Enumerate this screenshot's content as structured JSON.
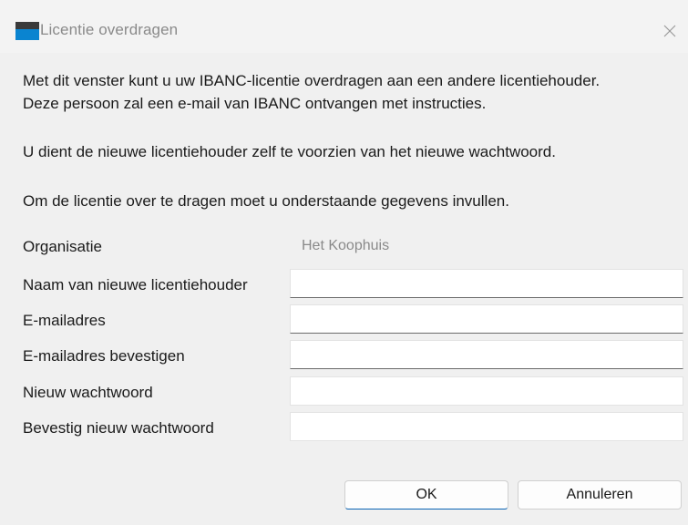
{
  "window": {
    "title": "Licentie overdragen",
    "close_label": "×"
  },
  "intro": {
    "line1": "Met dit venster kunt u uw IBANC-licentie overdragen aan een andere licentiehouder.",
    "line2": "Deze persoon zal een e-mail van IBANC ontvangen met instructies.",
    "line3": "U dient de nieuwe licentiehouder zelf te voorzien van het nieuwe wachtwoord.",
    "line4": "Om de licentie over te dragen moet u onderstaande gegevens invullen."
  },
  "form": {
    "organisation": {
      "label": "Organisatie",
      "value": "Het Koophuis"
    },
    "new_holder_name": {
      "label": "Naam van nieuwe licentiehouder",
      "value": ""
    },
    "email": {
      "label": "E-mailadres",
      "value": ""
    },
    "email_confirm": {
      "label": "E-mailadres bevestigen",
      "value": ""
    },
    "new_password": {
      "label": "Nieuw wachtwoord",
      "value": ""
    },
    "new_password_confirm": {
      "label": "Bevestig nieuw wachtwoord",
      "value": ""
    }
  },
  "buttons": {
    "ok": "OK",
    "cancel": "Annuleren"
  },
  "colors": {
    "accent": "#0a84d0",
    "background": "#f0f0f0"
  }
}
